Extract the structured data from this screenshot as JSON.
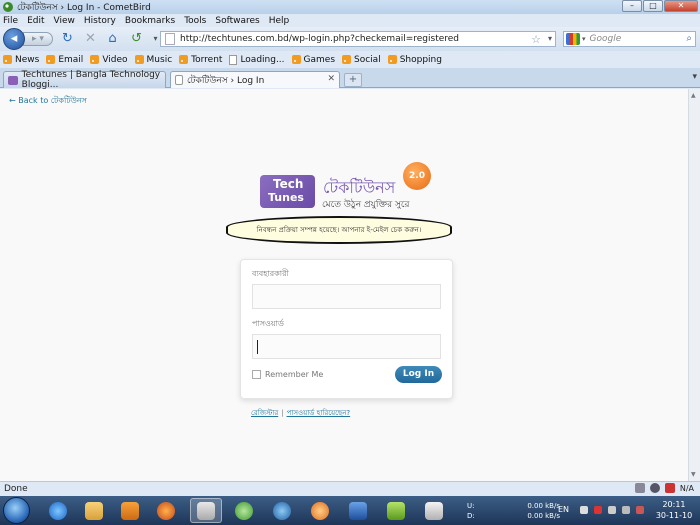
{
  "window": {
    "title": "টেকটিউনস › Log In - CometBird",
    "controls": [
      "–",
      "□",
      "✕"
    ]
  },
  "menu": [
    "File",
    "Edit",
    "View",
    "History",
    "Bookmarks",
    "Tools",
    "Softwares",
    "Help"
  ],
  "nav": {
    "url": "http://techtunes.com.bd/wp-login.php?checkemail=registered",
    "search_placeholder": "Google"
  },
  "bookmarks": [
    "News",
    "Email",
    "Video",
    "Music",
    "Torrent",
    "Loading...",
    "Games",
    "Social",
    "Shopping"
  ],
  "tabs": [
    {
      "label": "Techtunes | Bangla Technology Bloggi..."
    },
    {
      "label": "টেকটিউনস › Log In"
    }
  ],
  "page": {
    "back_link": "← Back to টেকটিউনস",
    "logo": {
      "tech": "Tech",
      "tunes": "Tunes",
      "bangla": "টেকটিউনস",
      "tagline": "মেতে উঠুন প্রযুক্তির সুরে",
      "badge": "2.0"
    },
    "notice": "নিবন্ধন প্রক্রিয়া সম্পন্ন হয়েছে। আপনার ই-মেইল চেক করুন।",
    "form": {
      "username_label": "ব্যবহারকারী",
      "password_label": "পাসওয়ার্ড",
      "username_value": "",
      "password_value": "",
      "remember_label": "Remember Me",
      "login_button": "Log In"
    },
    "links": {
      "register": "রেজিস্টার",
      "separator": "|",
      "lost_password": "পাসওয়ার্ড হারিয়েছেন?"
    }
  },
  "status": {
    "text": "Done",
    "indicator": "N/A"
  },
  "taskbar": {
    "network": {
      "up_label": "U:",
      "down_label": "D:",
      "up": "0.00 kB/s",
      "down": "0.00 kB/s"
    },
    "language": "EN",
    "time": "20:11",
    "date": "30-11-10"
  }
}
